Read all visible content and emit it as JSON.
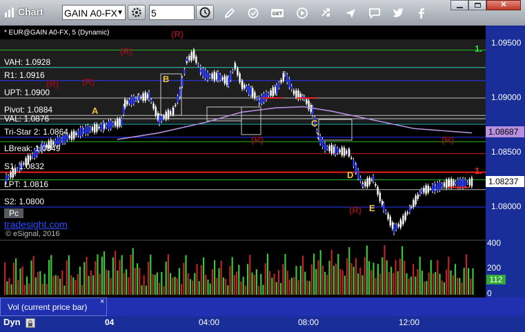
{
  "toolbar": {
    "title": "Chart",
    "symbol": "GAIN A0-FX",
    "interval": "5",
    "colors": {
      "bg_top": "#cfd3d9",
      "bg_bottom": "#9aa1aa"
    },
    "icons": [
      "chart-icon",
      "symbol-dropdown-icon",
      "gear-icon",
      "clock-icon",
      "pencil-icon",
      "refresh-icon",
      "get-icon",
      "play-icon",
      "swap-icon",
      "comment-icon",
      "twitter-icon",
      "facebook-icon"
    ],
    "window_controls": [
      "minimize",
      "maximize",
      "close"
    ]
  },
  "chart_header": "* EUR@GAIN A0-FX, 5 (Dynamic)",
  "price_levels": [
    {
      "label": "VAH: 1.0928",
      "value": 1.0928,
      "color": "#33cccc"
    },
    {
      "label": "R1: 1.0916",
      "value": 1.0916,
      "color": "#2a3cff"
    },
    {
      "label": "UPT: 1.0900",
      "value": 1.09,
      "color": "#bbbbbb"
    },
    {
      "label": "Pivot: 1.0884",
      "value": 1.0884,
      "color": "#bbbbbb"
    },
    {
      "label": "VAL: 1.0876",
      "value": 1.0876,
      "color": "#33cccc"
    },
    {
      "label": "Tri-Star 2: 1.0864",
      "value": 1.0864,
      "color": "#2a3cff"
    },
    {
      "label": "LBreak: 1.0849",
      "value": 1.0849,
      "color": "#cc2222"
    },
    {
      "label": "S1: 1.0832",
      "value": 1.0832,
      "color": "#ee2222"
    },
    {
      "label": "LPT: 1.0816",
      "value": 1.0816,
      "color": "#bbbbbb"
    },
    {
      "label": "S2: 1.0800",
      "value": 1.08,
      "color": "#2a3cff"
    }
  ],
  "extra_lines": [
    {
      "value": 1.0944,
      "color": "#22bb22"
    },
    {
      "value": 1.0881,
      "color": "#cccccc"
    },
    {
      "value": 1.086,
      "color": "#22bb22"
    },
    {
      "value": 1.0825,
      "color": "#22bb22"
    }
  ],
  "price_axis": {
    "ticks": [
      "1.09500",
      "1.09000",
      "1.08500",
      "1.08000"
    ],
    "markers": [
      {
        "label": "1.08687",
        "value": 1.08687,
        "color": "#b890e0"
      },
      {
        "label": "1.08237",
        "value": 1.08237,
        "color": "#ffffff"
      }
    ]
  },
  "right_edge_text": [
    {
      "text": "1.",
      "color": "#33dd33",
      "value": 1.0944
    },
    {
      "text": "1.",
      "color": "#ee2222",
      "value": 1.0832
    }
  ],
  "annotations": {
    "letters": [
      {
        "text": "A",
        "color": "#f0c040"
      },
      {
        "text": "B",
        "color": "#f0c040"
      },
      {
        "text": "C",
        "color": "#f0c040"
      },
      {
        "text": "D",
        "color": "#f0c040"
      },
      {
        "text": "E",
        "color": "#f0c040"
      }
    ],
    "r_marks": [
      "(R)",
      "(R)",
      "(R)",
      "(R)",
      "(R)",
      "(R)",
      "(R)"
    ]
  },
  "branding": {
    "site": "tradesight.com",
    "pc": "Pc",
    "copyright": "© eSignal, 2016"
  },
  "volume": {
    "ticks": [
      "400",
      "200",
      "0"
    ],
    "current": "112",
    "label": "Vol (current price bar)",
    "close": "×"
  },
  "time_axis": {
    "dyn": "Dyn",
    "labels": [
      "04",
      "04:00",
      "08:00",
      "12:00"
    ]
  }
}
